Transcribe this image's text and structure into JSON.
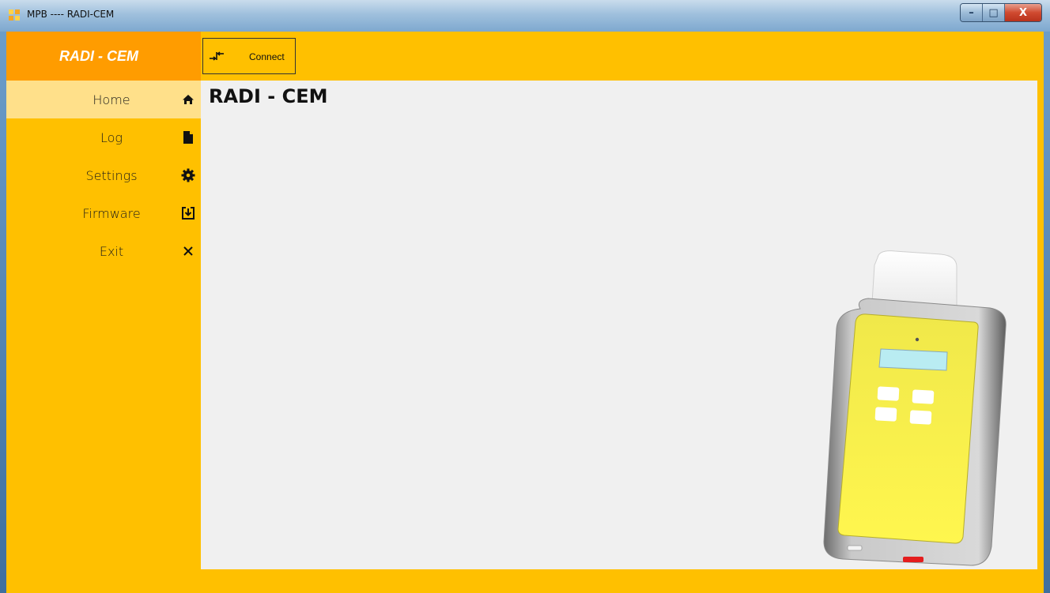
{
  "window": {
    "title": "MPB ---- RADI-CEM",
    "min_label": "–",
    "max_label": "□",
    "close_label": "X"
  },
  "sidebar": {
    "brand": "RADI - CEM",
    "items": [
      {
        "label": "Home",
        "icon": "home-icon",
        "active": true
      },
      {
        "label": "Log",
        "icon": "file-icon",
        "active": false
      },
      {
        "label": "Settings",
        "icon": "gear-icon",
        "active": false
      },
      {
        "label": "Firmware",
        "icon": "download-box-icon",
        "active": false
      },
      {
        "label": "Exit",
        "icon": "close-icon",
        "active": false
      }
    ]
  },
  "toolbar": {
    "connect_label": "Connect",
    "connect_icon": "connect-arrows-icon"
  },
  "main": {
    "title": "RADI - CEM"
  },
  "colors": {
    "accent": "#ffc000",
    "brand_bg": "#ff9c00",
    "active_item": "#ffe08a",
    "content_bg": "#f0f0f0"
  }
}
